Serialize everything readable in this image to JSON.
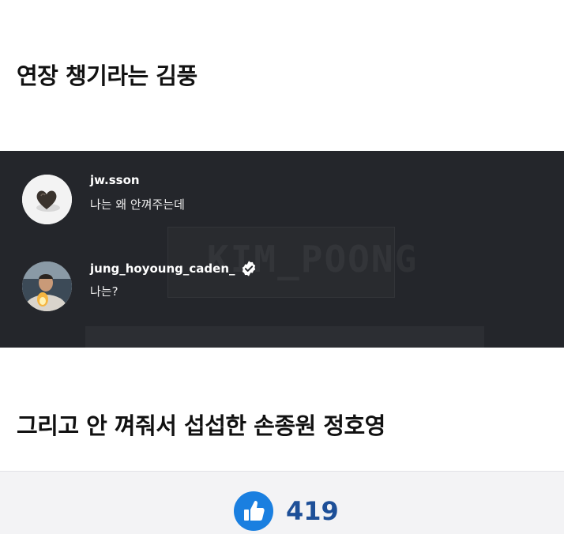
{
  "headings": {
    "first": "연장 챙기라는 김풍",
    "second": "그리고 안 껴줘서 섭섭한 손종원 정호영"
  },
  "screenshot": {
    "background_text": "KIM_POONG",
    "comments": [
      {
        "username": "jw.sson",
        "text": "나는 왜 안껴주는데",
        "verified": false,
        "avatar": "heart-object-avatar"
      },
      {
        "username": "jung_hoyoung_caden_",
        "text": "나는?",
        "verified": true,
        "avatar": "person-photo-avatar"
      }
    ]
  },
  "footer": {
    "like_count": "419",
    "like_icon": "thumbs-up-icon",
    "accent_color": "#1a7fe0",
    "count_color": "#1d4f98"
  }
}
